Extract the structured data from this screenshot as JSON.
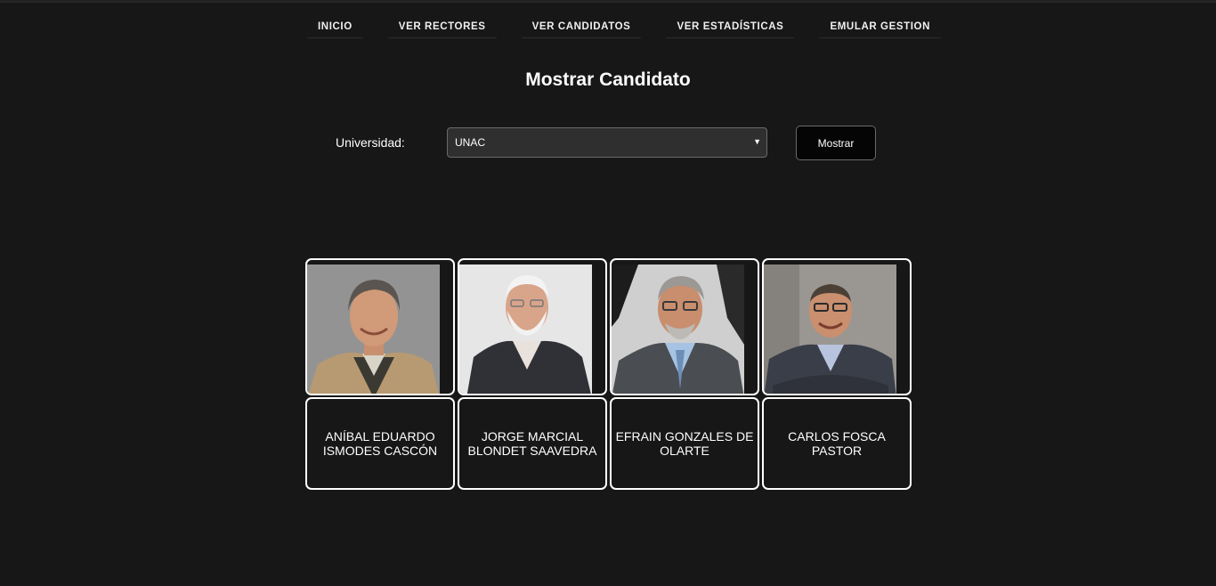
{
  "nav": {
    "items": [
      {
        "label": "INICIO"
      },
      {
        "label": "VER RECTORES"
      },
      {
        "label": "VER CANDIDATOS"
      },
      {
        "label": "VER ESTADÍSTICAS"
      },
      {
        "label": "EMULAR GESTION"
      }
    ],
    "separator_color": "#c8102e"
  },
  "page": {
    "title": "Mostrar Candidato"
  },
  "form": {
    "university_label": "Universidad:",
    "university_selected": "UNAC",
    "submit_label": "Mostrar"
  },
  "candidates": [
    {
      "name": "ANÍBAL EDUARDO ISMODES CASCÓN",
      "photo": "portrait-beige-jacket"
    },
    {
      "name": "JORGE MARCIAL BLONDET SAAVEDRA",
      "photo": "portrait-dark-suit-white-beard"
    },
    {
      "name": "EFRAIN GONZALES DE OLARTE",
      "photo": "portrait-grey-suit-glasses"
    },
    {
      "name": "CARLOS FOSCA PASTOR",
      "photo": "portrait-suit-arms-crossed"
    }
  ],
  "colors": {
    "background": "#171717",
    "text": "#ffffff",
    "accent": "#c8102e"
  }
}
